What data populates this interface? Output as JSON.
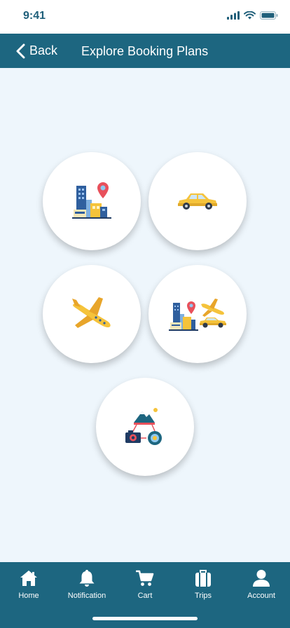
{
  "status_bar": {
    "time": "9:41"
  },
  "header": {
    "back_label": "Back",
    "title": "Explore Booking Plans"
  },
  "plans": [
    {
      "icon": "hotel-icon"
    },
    {
      "icon": "taxi-icon"
    },
    {
      "icon": "flight-icon"
    },
    {
      "icon": "hotel-flight-taxi-icon"
    },
    {
      "icon": "sightseeing-icon"
    }
  ],
  "tabs": [
    {
      "label": "Home",
      "icon": "home-icon"
    },
    {
      "label": "Notification",
      "icon": "bell-icon"
    },
    {
      "label": "Cart",
      "icon": "cart-icon"
    },
    {
      "label": "Trips",
      "icon": "suitcase-icon"
    },
    {
      "label": "Account",
      "icon": "user-icon"
    }
  ],
  "colors": {
    "primary": "#1d6680",
    "background": "#eef6fc",
    "accent_yellow": "#f5c33b",
    "pin_red": "#e8505b"
  }
}
